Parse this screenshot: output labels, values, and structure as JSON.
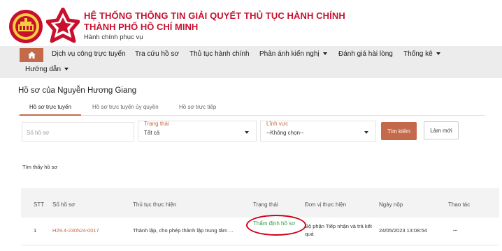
{
  "header": {
    "title_line1": "HỆ THỐNG THÔNG TIN GIẢI QUYẾT THỦ TỤC HÀNH CHÍNH",
    "title_line2": "THÀNH PHỐ HỒ CHÍ MINH",
    "subtitle": "Hành chính phục vụ",
    "brand_color": "#c8102e"
  },
  "nav": {
    "home_icon": "home-icon",
    "items": [
      {
        "label": "Dịch vụ công trực tuyến"
      },
      {
        "label": "Tra cứu hồ sơ"
      },
      {
        "label": "Thủ tục hành chính"
      },
      {
        "label": "Phản ánh kiến nghị"
      },
      {
        "label": "Đánh giá hài lòng"
      },
      {
        "label": "Thống kê"
      },
      {
        "label": "Hướng dẫn"
      }
    ],
    "accent": "#c46a4b"
  },
  "page": {
    "title": "Hồ sơ của Nguyễn Hương Giang",
    "tabs": [
      {
        "label": "Hồ sơ trực tuyến"
      },
      {
        "label": "Hồ sơ trực tuyến ủy quyền"
      },
      {
        "label": "Hồ sơ trực tiếp"
      }
    ]
  },
  "filters": {
    "code_placeholder": "Số hồ sơ",
    "status_label": "Trạng thái",
    "status_value": "Tất cả",
    "field_label": "Lĩnh vực",
    "field_value": "--Không chọn--",
    "search_label": "Tìm kiếm",
    "reset_label": "Làm mới"
  },
  "results": {
    "found_text": "Tìm thấy hồ sơ"
  },
  "table": {
    "headers": [
      "STT",
      "Số hồ sơ",
      "Thủ tục thực hiện",
      "Trạng thái",
      "Đơn vị thực hiện",
      "Ngày nộp",
      "Thao tác"
    ],
    "rows": [
      {
        "stt": "1",
        "code": "H29.4-230524-0017",
        "procedure": "Thành lập, cho phép thành lập trung tâm ...",
        "status": "Thẩm định hồ sơ",
        "unit_line1": "Bộ phận Tiếp nhận và trả kết",
        "unit_line2": "quả",
        "date": "24/05/2023 13:08:54",
        "actions": "..."
      }
    ],
    "status_color": "#2e9d45",
    "highlight_color": "#d0001a"
  }
}
